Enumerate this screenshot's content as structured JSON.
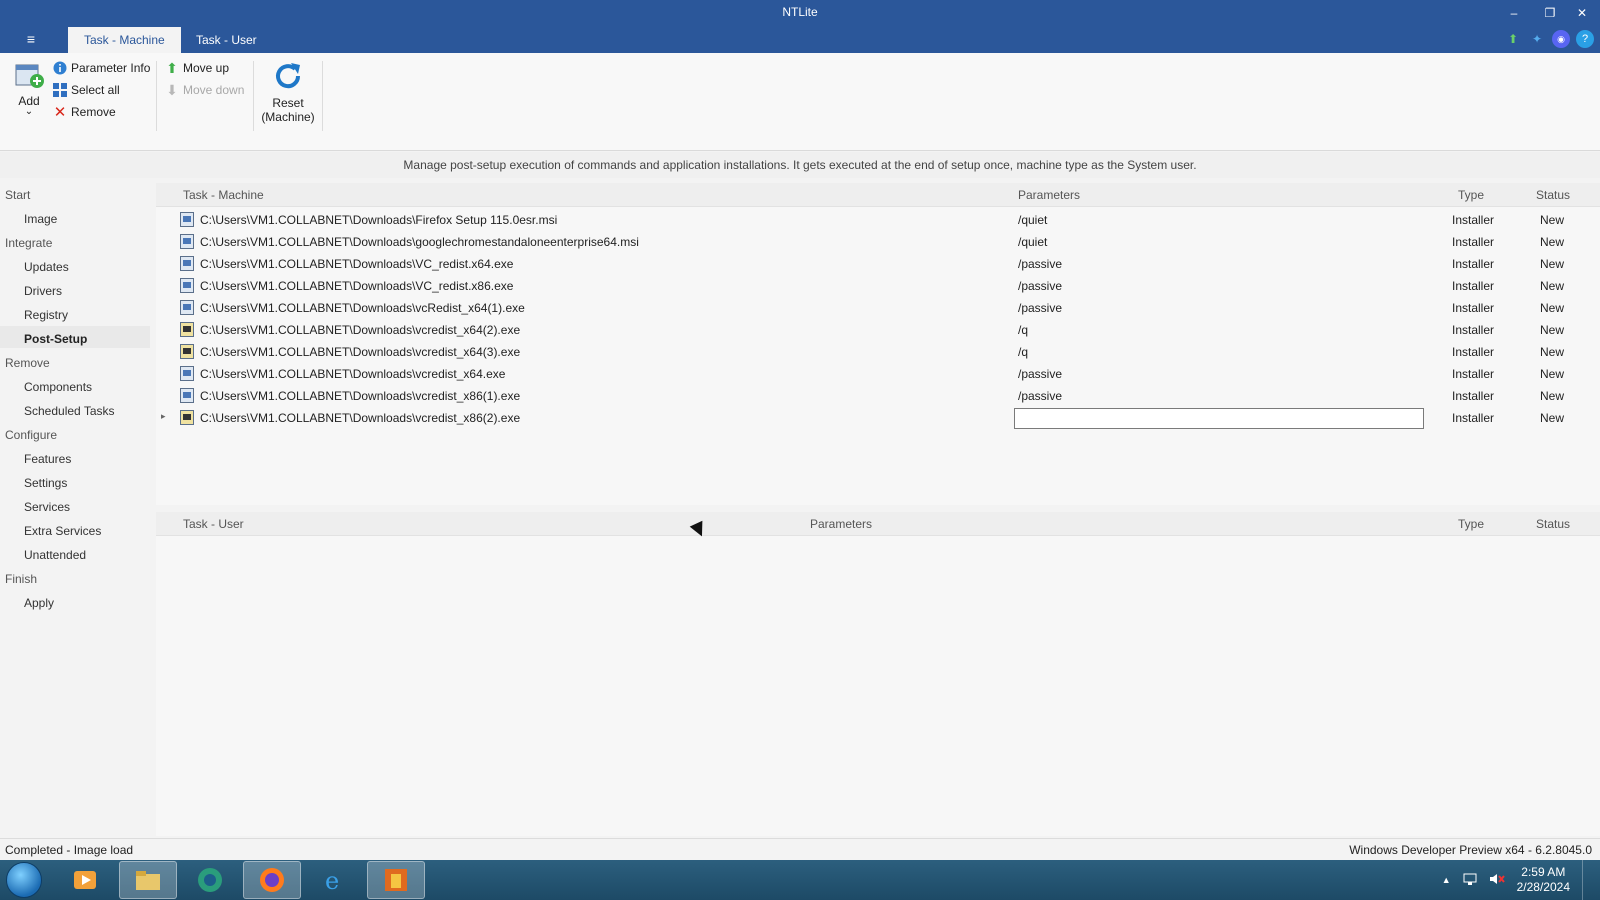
{
  "window": {
    "title": "NTLite",
    "minimize_glyph": "–",
    "restore_glyph": "❐",
    "close_glyph": "✕",
    "menu_glyph": "≡"
  },
  "tabs": [
    {
      "label": "Task - Machine",
      "active": true
    },
    {
      "label": "Task - User",
      "active": false
    }
  ],
  "top_icons": [
    "update-arrow-icon",
    "twitter-icon",
    "discord-icon",
    "help-icon"
  ],
  "ribbon": {
    "add_label": "Add",
    "add_chevron": "⌄",
    "parameter_info_label": "Parameter Info",
    "select_all_label": "Select all",
    "remove_label": "Remove",
    "move_up_label": "Move up",
    "move_down_label": "Move down",
    "reset_label_line1": "Reset",
    "reset_label_line2": "(Machine)"
  },
  "description": "Manage post-setup execution of commands and application installations. It gets executed at the end of setup once, machine type as the System user.",
  "sidebar": {
    "groups": [
      {
        "label": "Start",
        "items": [
          "Image"
        ]
      },
      {
        "label": "Integrate",
        "items": [
          "Updates",
          "Drivers",
          "Registry",
          "Post-Setup"
        ]
      },
      {
        "label": "Remove",
        "items": [
          "Components",
          "Scheduled Tasks"
        ]
      },
      {
        "label": "Configure",
        "items": [
          "Features",
          "Settings",
          "Services",
          "Extra Services",
          "Unattended"
        ]
      },
      {
        "label": "Finish",
        "items": [
          "Apply"
        ]
      }
    ],
    "selected": "Post-Setup"
  },
  "machine_table": {
    "columns": [
      "Task - Machine",
      "Parameters",
      "Type",
      "Status"
    ],
    "rows": [
      {
        "task": "C:\\Users\\VM1.COLLABNET\\Downloads\\Firefox Setup 115.0esr.msi",
        "params": "/quiet",
        "type": "Installer",
        "status": "New",
        "icon": "msi"
      },
      {
        "task": "C:\\Users\\VM1.COLLABNET\\Downloads\\googlechromestandaloneenterprise64.msi",
        "params": "/quiet",
        "type": "Installer",
        "status": "New",
        "icon": "msi"
      },
      {
        "task": "C:\\Users\\VM1.COLLABNET\\Downloads\\VC_redist.x64.exe",
        "params": "/passive",
        "type": "Installer",
        "status": "New",
        "icon": "msi"
      },
      {
        "task": "C:\\Users\\VM1.COLLABNET\\Downloads\\VC_redist.x86.exe",
        "params": "/passive",
        "type": "Installer",
        "status": "New",
        "icon": "msi"
      },
      {
        "task": "C:\\Users\\VM1.COLLABNET\\Downloads\\vcRedist_x64(1).exe",
        "params": "/passive",
        "type": "Installer",
        "status": "New",
        "icon": "msi"
      },
      {
        "task": "C:\\Users\\VM1.COLLABNET\\Downloads\\vcredist_x64(2).exe",
        "params": "/q",
        "type": "Installer",
        "status": "New",
        "icon": "exe"
      },
      {
        "task": "C:\\Users\\VM1.COLLABNET\\Downloads\\vcredist_x64(3).exe",
        "params": "/q",
        "type": "Installer",
        "status": "New",
        "icon": "exe"
      },
      {
        "task": "C:\\Users\\VM1.COLLABNET\\Downloads\\vcredist_x64.exe",
        "params": "/passive",
        "type": "Installer",
        "status": "New",
        "icon": "msi"
      },
      {
        "task": "C:\\Users\\VM1.COLLABNET\\Downloads\\vcredist_x86(1).exe",
        "params": "/passive",
        "type": "Installer",
        "status": "New",
        "icon": "msi"
      },
      {
        "task": "C:\\Users\\VM1.COLLABNET\\Downloads\\vcredist_x86(2).exe",
        "params": "",
        "type": "Installer",
        "status": "New",
        "icon": "exe",
        "editing": true,
        "expander": "▸"
      }
    ]
  },
  "user_table": {
    "columns": [
      "Task - User",
      "Parameters",
      "Type",
      "Status"
    ]
  },
  "statusbar": {
    "left": "Completed - Image load",
    "right": "Windows Developer Preview x64 - 6.2.8045.0"
  },
  "taskbar": {
    "apps": [
      "media-player-icon",
      "file-explorer-icon",
      "network-icon",
      "firefox-icon",
      "internet-explorer-icon",
      "ntlite-icon"
    ],
    "tray_arrow": "▲",
    "time": "2:59 AM",
    "date": "2/28/2024"
  },
  "colors": {
    "accent": "#2b579a",
    "taskbar": "#1d4a66"
  }
}
